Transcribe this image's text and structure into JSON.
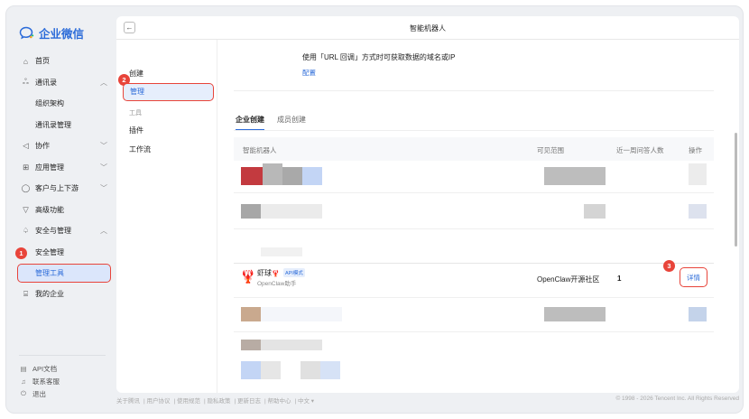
{
  "app": {
    "brand_name": "企业微信"
  },
  "sidebar": {
    "items": [
      {
        "label": "首页",
        "icon": "home-icon"
      },
      {
        "label": "通讯录",
        "icon": "contacts-icon",
        "chevron": "up"
      },
      {
        "label": "组织架构",
        "sub": true
      },
      {
        "label": "通讯录管理",
        "sub": true
      },
      {
        "label": "协作",
        "icon": "collab-icon",
        "chevron": "down"
      },
      {
        "label": "应用管理",
        "icon": "apps-icon",
        "chevron": "down"
      },
      {
        "label": "客户与上下游",
        "icon": "customer-icon",
        "chevron": "down"
      },
      {
        "label": "高级功能",
        "icon": "advanced-icon"
      },
      {
        "label": "安全与管理",
        "icon": "security-icon",
        "chevron": "up"
      },
      {
        "label": "安全管理",
        "sub": true
      },
      {
        "label": "管理工具",
        "sub": true,
        "active": true
      },
      {
        "label": "我的企业",
        "icon": "company-icon"
      }
    ],
    "bottom": [
      {
        "label": "API文档",
        "icon": "doc-icon"
      },
      {
        "label": "联系客服",
        "icon": "support-icon"
      },
      {
        "label": "退出",
        "icon": "power-icon"
      }
    ]
  },
  "badges": {
    "one": "1",
    "two": "2",
    "three": "3"
  },
  "header": {
    "back_glyph": "←",
    "title": "智能机器人"
  },
  "subnav": {
    "create": "创建",
    "manage": "管理",
    "group_tools": "工具",
    "plugin": "插件",
    "workflow": "工作流"
  },
  "content": {
    "description": "使用「URL 回调」方式时可获取数据的域名或IP",
    "config_link": "配置",
    "tabs": [
      "企业创建",
      "成员创建"
    ],
    "columns": {
      "name": "智能机器人",
      "scope": "可见范围",
      "count": "近一周问答人数",
      "action": "操作"
    },
    "bot": {
      "name": "虾球",
      "emoji": "🦞",
      "tag": "API模式",
      "subtitle": "OpenClaw助手",
      "scope": "OpenClaw开源社区",
      "count": "1",
      "action_label": "详情"
    }
  },
  "footer": {
    "links": [
      "关于腾讯",
      "用户协议",
      "使用规范",
      "隐私政策",
      "更新日志",
      "帮助中心",
      "中文 ▾"
    ],
    "copyright": "© 1998 - 2026 Tencent Inc. All Rights Reserved"
  },
  "colors": {
    "accent": "#2b6bd9",
    "highlight_border": "#e8443a",
    "active_bg": "#dbe6fb"
  }
}
